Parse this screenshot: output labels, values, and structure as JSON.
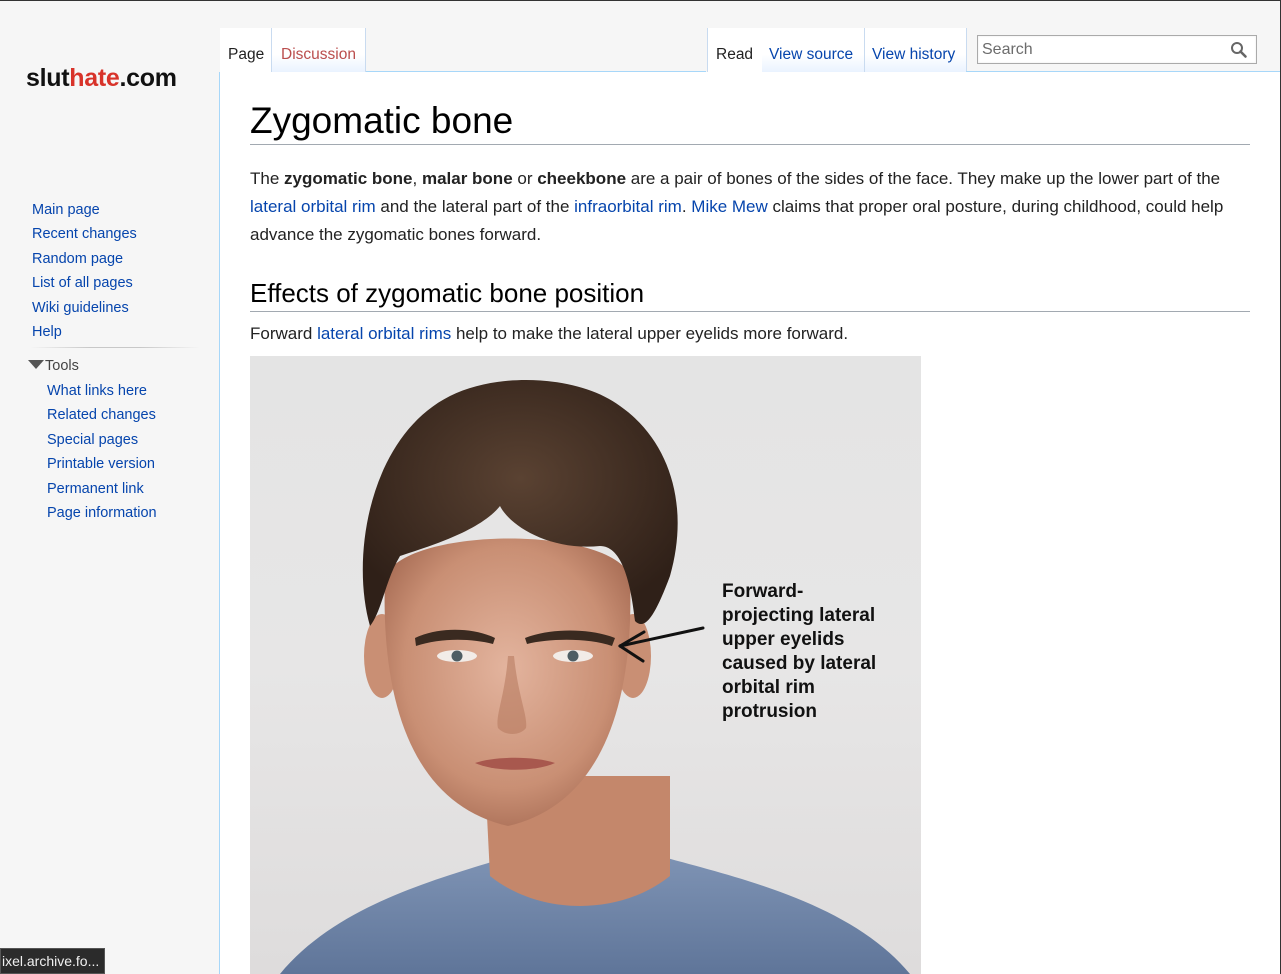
{
  "site": {
    "logo_part1": "slut",
    "logo_part2": "hate",
    "logo_part3": ".com"
  },
  "tabs": {
    "page": "Page",
    "discussion": "Discussion",
    "read": "Read",
    "view_source": "View source",
    "view_history": "View history"
  },
  "search": {
    "placeholder": "Search"
  },
  "sidebar": {
    "nav": [
      "Main page",
      "Recent changes",
      "Random page",
      "List of all pages",
      "Wiki guidelines",
      "Help"
    ],
    "tools_heading": "Tools",
    "tools": [
      "What links here",
      "Related changes",
      "Special pages",
      "Printable version",
      "Permanent link",
      "Page information"
    ]
  },
  "article": {
    "title": "Zygomatic bone",
    "p1": {
      "t1": "The ",
      "b1": "zygomatic bone",
      "t2": ", ",
      "b2": "malar bone",
      "t3": " or ",
      "b3": "cheekbone",
      "t4": " are a pair of bones of the sides of the face. They make up the lower part of the ",
      "link1": "lateral orbital rim",
      "t5": " and the lateral part of the ",
      "link2": "infraorbital rim",
      "t6": ". ",
      "link3": "Mike Mew",
      "t7": " claims that proper oral posture, during childhood, could help advance the zygomatic bones forward."
    },
    "section1": {
      "heading": "Effects of zygomatic bone position",
      "p_t1": "Forward ",
      "p_link": "lateral orbital rims",
      "p_t2": " help to make the lateral upper eyelids more forward."
    },
    "figure_label": [
      "Forward-",
      "projecting lateral",
      "upper eyelids",
      "caused by lateral",
      "orbital rim",
      "protrusion"
    ]
  },
  "statusbar": {
    "text": "ixel.archive.fo..."
  }
}
